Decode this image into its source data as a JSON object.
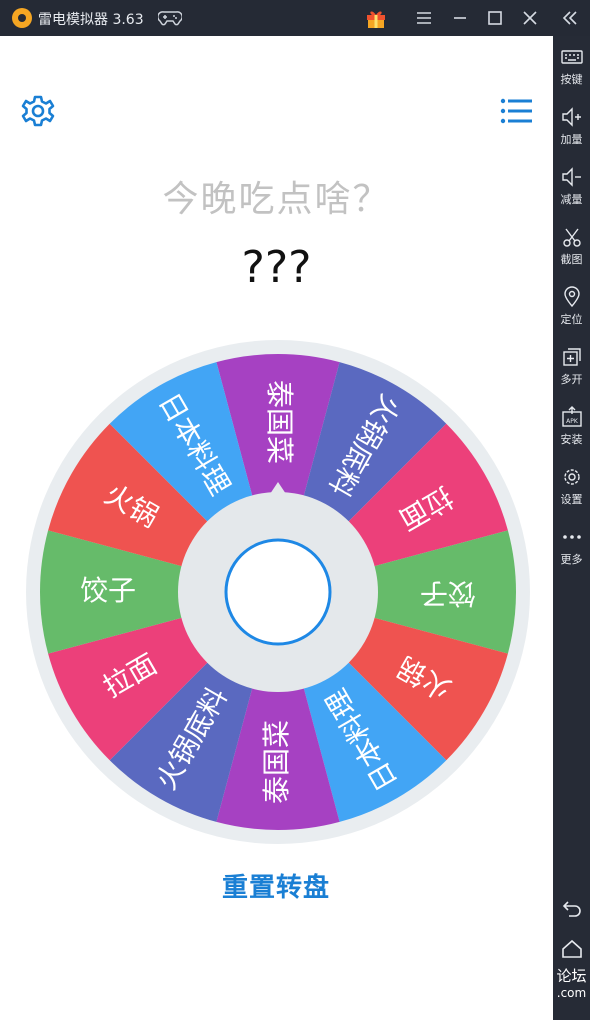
{
  "window": {
    "title": "雷电模拟器 3.63"
  },
  "sidebar": {
    "items": [
      {
        "label": "按键",
        "icon": "keyboard-icon"
      },
      {
        "label": "加量",
        "icon": "volume-up-icon"
      },
      {
        "label": "减量",
        "icon": "volume-down-icon"
      },
      {
        "label": "截图",
        "icon": "scissors-icon"
      },
      {
        "label": "定位",
        "icon": "location-icon"
      },
      {
        "label": "多开",
        "icon": "multi-open-icon"
      },
      {
        "label": "安装",
        "icon": "apk-install-icon"
      },
      {
        "label": "设置",
        "icon": "gear-icon"
      },
      {
        "label": "更多",
        "icon": "more-icon"
      }
    ],
    "watermark": [
      "论坛",
      ".com"
    ]
  },
  "app": {
    "question": "今晚吃点啥？",
    "result": "???",
    "reset_label": "重置转盘"
  },
  "wheel": {
    "segments": [
      {
        "label": "泰国菜",
        "color": "#a641c2"
      },
      {
        "label": "火锅底料",
        "color": "#5a69c0"
      },
      {
        "label": "拉面",
        "color": "#ec407a"
      },
      {
        "label": "饺子",
        "color": "#66bb6a"
      },
      {
        "label": "火锅",
        "color": "#ef5350"
      },
      {
        "label": "日本料理",
        "color": "#42a5f5"
      },
      {
        "label": "泰国菜",
        "color": "#a641c2"
      },
      {
        "label": "火锅底料",
        "color": "#5a69c0"
      },
      {
        "label": "拉面",
        "color": "#ec407a"
      },
      {
        "label": "饺子",
        "color": "#66bb6a"
      },
      {
        "label": "火锅",
        "color": "#ef5350"
      },
      {
        "label": "日本料理",
        "color": "#42a5f5"
      }
    ],
    "hub_ring_color": "#1e88e5"
  },
  "colors": {
    "accent": "#1a7fd4",
    "titlebar": "#252a35",
    "sidebar": "#262b36"
  }
}
